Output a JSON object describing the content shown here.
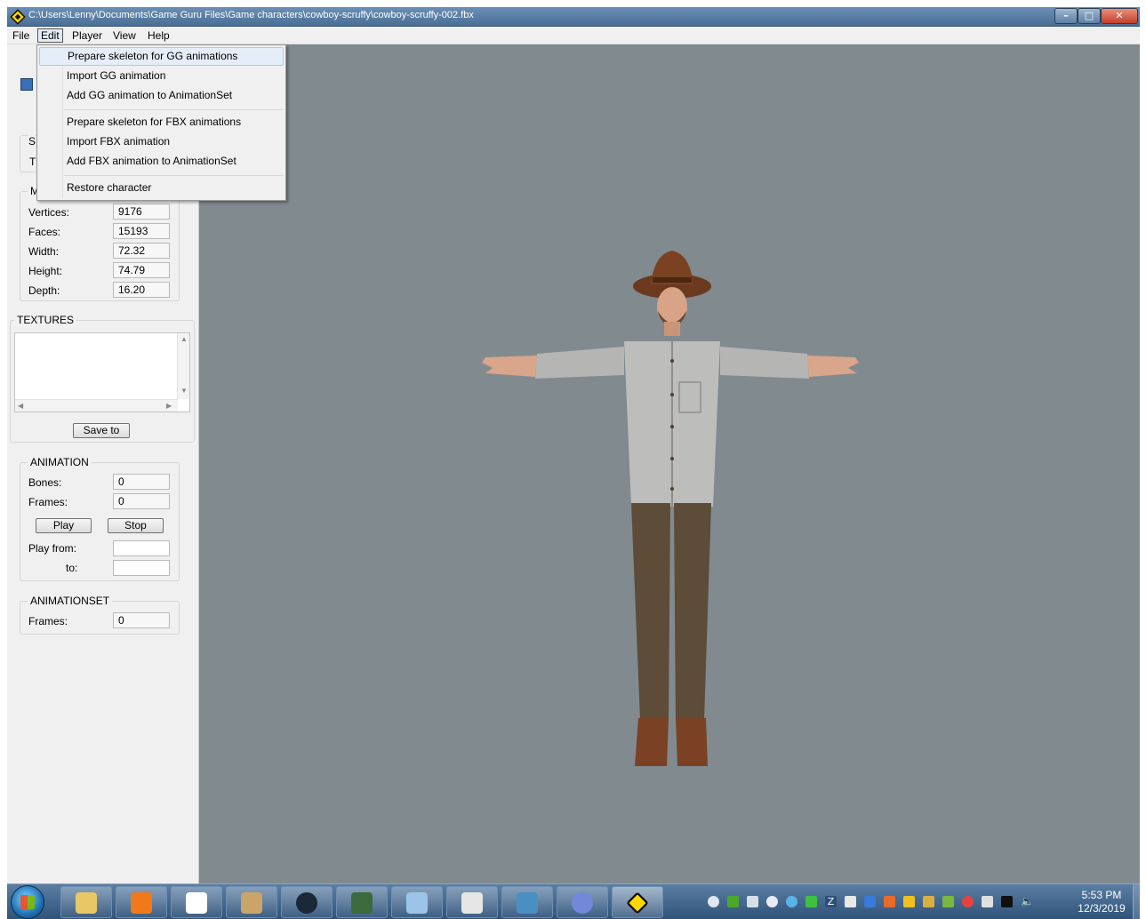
{
  "window": {
    "title": "C:\\Users\\Lenny\\Documents\\Game Guru Files\\Game characters\\cowboy-scruffy\\cowboy-scruffy-002.fbx"
  },
  "menubar": {
    "file": "File",
    "edit": "Edit",
    "player": "Player",
    "view": "View",
    "help": "Help"
  },
  "edit_menu": {
    "items": [
      "Prepare skeleton for GG animations",
      "Import GG animation",
      "Add GG animation to AnimationSet",
      "Prepare skeleton for FBX animations",
      "Import FBX animation",
      "Add FBX animation to AnimationSet",
      "Restore character"
    ],
    "highlighted_index": 0
  },
  "panel": {
    "partial_labels": {
      "s_group": "S",
      "t_row": "T",
      "m_group": "M"
    },
    "mesh": {
      "vertices_label": "Vertices:",
      "vertices": "9176",
      "faces_label": "Faces:",
      "faces": "15193",
      "width_label": "Width:",
      "width": "72.32",
      "height_label": "Height:",
      "height": "74.79",
      "depth_label": "Depth:",
      "depth": "16.20"
    },
    "textures": {
      "title": "TEXTURES",
      "save_button": "Save to"
    },
    "animation": {
      "title": "ANIMATION",
      "bones_label": "Bones:",
      "bones": "0",
      "frames_label": "Frames:",
      "frames": "0",
      "play_button": "Play",
      "stop_button": "Stop",
      "play_from_label": "Play from:",
      "to_label": "to:",
      "play_from": "",
      "to": ""
    },
    "animationset": {
      "title": "ANIMATIONSET",
      "frames_label": "Frames:",
      "frames": "0"
    }
  },
  "viewport": {
    "background": "#818a8f",
    "model": "cowboy character in T-pose"
  },
  "taskbar": {
    "clock_time": "5:53 PM",
    "clock_date": "12/3/2019",
    "pinned_icons": [
      "explorer-icon",
      "media-player-icon",
      "notepad-icon",
      "paint-icon",
      "steam-icon",
      "screen-icon",
      "control-panel-icon",
      "document-icon",
      "image-viewer-icon",
      "discord-icon",
      "gameguru-icon"
    ]
  },
  "colors": {
    "viewport_bg": "#818a8f",
    "panel_bg": "#f0f0f0",
    "menu_highlight": "#e5eef8"
  }
}
